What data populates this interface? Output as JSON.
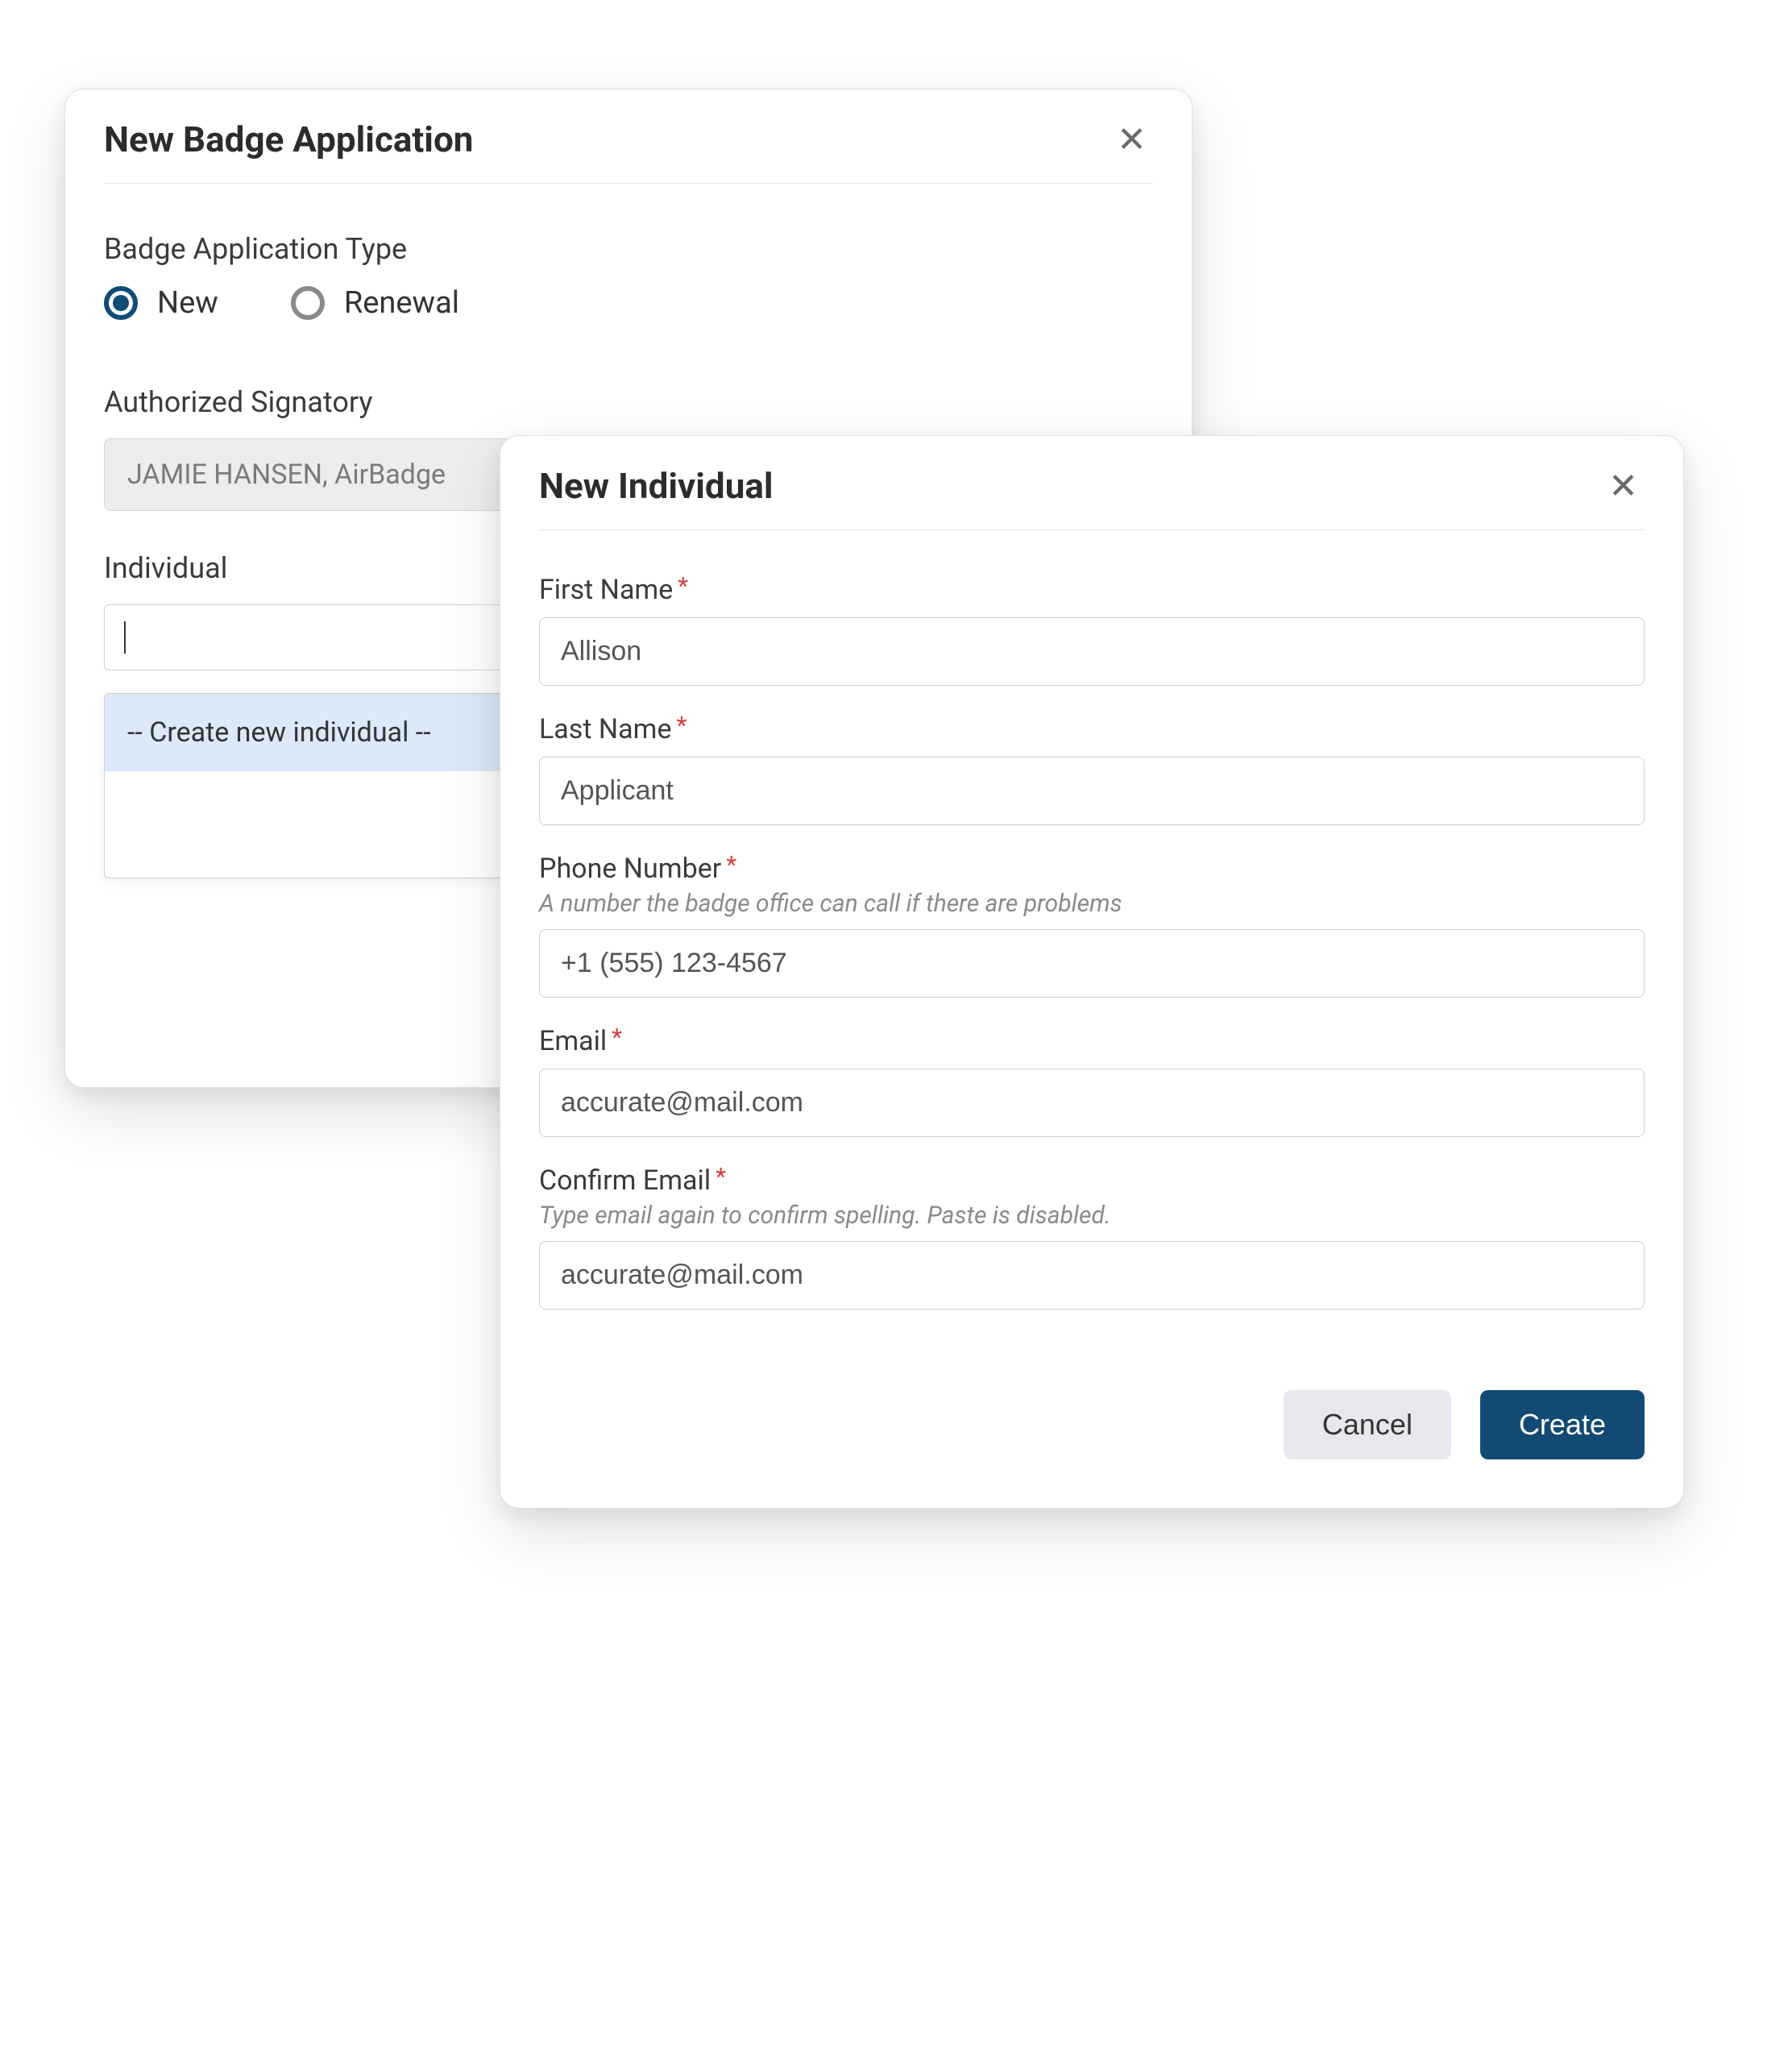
{
  "badge_modal": {
    "title": "New Badge Application",
    "type_label": "Badge Application Type",
    "radio_new": "New",
    "radio_renewal": "Renewal",
    "signatory_label": "Authorized Signatory",
    "signatory_value": "JAMIE HANSEN, AirBadge",
    "individual_label": "Individual",
    "individual_value": "",
    "create_option": "-- Create new individual --"
  },
  "individual_modal": {
    "title": "New Individual",
    "first_name_label": "First Name",
    "first_name_value": "Allison",
    "last_name_label": "Last Name",
    "last_name_value": "Applicant",
    "phone_label": "Phone Number",
    "phone_helper": "A number the badge office can call if there are problems",
    "phone_value": "+1 (555) 123-4567",
    "email_label": "Email",
    "email_value": "accurate@mail.com",
    "confirm_label": "Confirm Email",
    "confirm_helper": "Type email again to confirm spelling. Paste is disabled.",
    "confirm_value": "accurate@mail.com",
    "cancel_label": "Cancel",
    "create_label": "Create"
  }
}
